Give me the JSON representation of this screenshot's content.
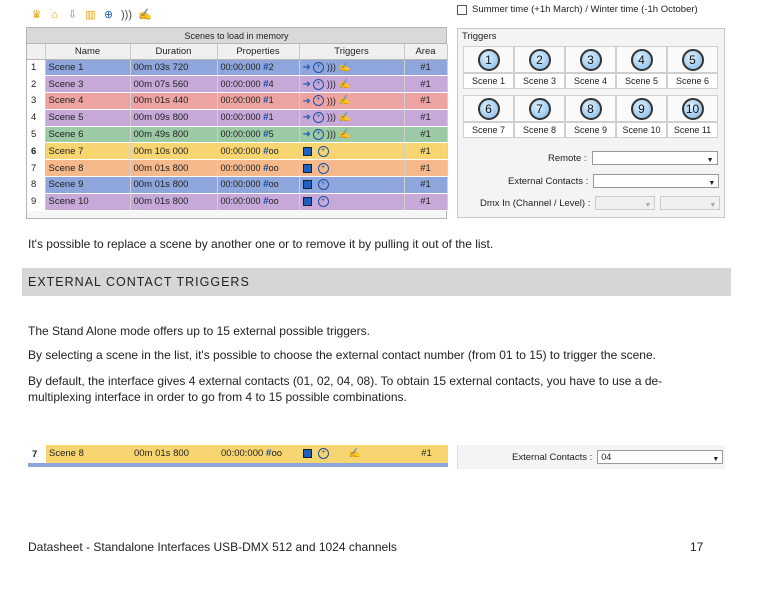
{
  "toolbar": {
    "icons": [
      "crown-icon",
      "home-icon",
      "arrow-down-icon",
      "columns-icon",
      "target-icon",
      "wave-icon",
      "hand-icon"
    ]
  },
  "scenes": {
    "title": "Scenes to load in memory",
    "headers": {
      "name": "Name",
      "duration": "Duration",
      "properties": "Properties",
      "triggers": "Triggers",
      "area": "Area"
    },
    "rows": [
      {
        "idx": "1",
        "name": "Scene 1",
        "duration": "00m 03s 720",
        "time": "00:00:000",
        "prop": "2",
        "area": "#1",
        "color": "#8ea6dc",
        "trig": "full"
      },
      {
        "idx": "2",
        "name": "Scene 3",
        "duration": "00m 07s 560",
        "time": "00:00:000",
        "prop": "4",
        "area": "#1",
        "color": "#c6a9d9",
        "trig": "full"
      },
      {
        "idx": "3",
        "name": "Scene 4",
        "duration": "00m 01s 440",
        "time": "00:00:000",
        "prop": "1",
        "area": "#1",
        "color": "#eea3a3",
        "trig": "full"
      },
      {
        "idx": "4",
        "name": "Scene 5",
        "duration": "00m 09s 800",
        "time": "00:00:000",
        "prop": "1",
        "area": "#1",
        "color": "#c6a9d9",
        "trig": "full"
      },
      {
        "idx": "5",
        "name": "Scene 6",
        "duration": "00m 49s 800",
        "time": "00:00:000",
        "prop": "5",
        "area": "#1",
        "color": "#9ccaa6",
        "trig": "full"
      },
      {
        "idx": "6",
        "name": "Scene 7",
        "duration": "00m 10s 000",
        "time": "00:00:000",
        "prop": "oo",
        "area": "#1",
        "color": "#f7d570",
        "trig": "short"
      },
      {
        "idx": "7",
        "name": "Scene 8",
        "duration": "00m 01s 800",
        "time": "00:00:000",
        "prop": "oo",
        "area": "#1",
        "color": "#f5b98c",
        "trig": "short"
      },
      {
        "idx": "8",
        "name": "Scene 9",
        "duration": "00m 01s 800",
        "time": "00:00:000",
        "prop": "oo",
        "area": "#1",
        "color": "#8ea6dc",
        "trig": "short"
      },
      {
        "idx": "9",
        "name": "Scene 10",
        "duration": "00m 01s 800",
        "time": "00:00:000",
        "prop": "oo",
        "area": "#1",
        "color": "#c6a9d9",
        "trig": "short"
      }
    ]
  },
  "right_panel": {
    "summer_label": "Summer time (+1h March) / Winter time (-1h October)",
    "triggers_title": "Triggers",
    "trigger_numbers": [
      "1",
      "2",
      "3",
      "4",
      "5",
      "6",
      "7",
      "8",
      "9",
      "10"
    ],
    "trigger_labels": [
      "Scene 1",
      "Scene 3",
      "Scene 4",
      "Scene 5",
      "Scene 6",
      "Scene 7",
      "Scene 8",
      "Scene 9",
      "Scene 10",
      "Scene 11"
    ],
    "remote_label": "Remote :",
    "external_label": "External Contacts :",
    "dmx_label": "Dmx In (Channel / Level) :"
  },
  "text": {
    "p1": "It's possible to replace a scene by another one or to remove it by pulling it out of the list.",
    "section": "EXTERNAL CONTACT TRIGGERS",
    "p2": "The Stand Alone mode offers up to 15 external possible triggers.",
    "p3": "By selecting a scene in the list, it's possible to choose the external contact number (from 01 to 15) to trigger the scene.",
    "p4a": "By default, the interface gives 4 external contacts (01, 02, 04, 08). To obtain 15 external contacts, you have to use a de-",
    "p4b": "multiplexing interface in order to go from 4 to 15 possible combinations."
  },
  "bottom_strip": {
    "idx": "7",
    "name": "Scene 8",
    "duration": "00m 01s 800",
    "time": "00:00:000",
    "prop": "oo",
    "area": "#1",
    "external_label": "External Contacts :",
    "external_value": "04"
  },
  "footer": {
    "title": "Datasheet - Standalone Interfaces USB-DMX 512 and 1024 channels",
    "page": "17"
  }
}
